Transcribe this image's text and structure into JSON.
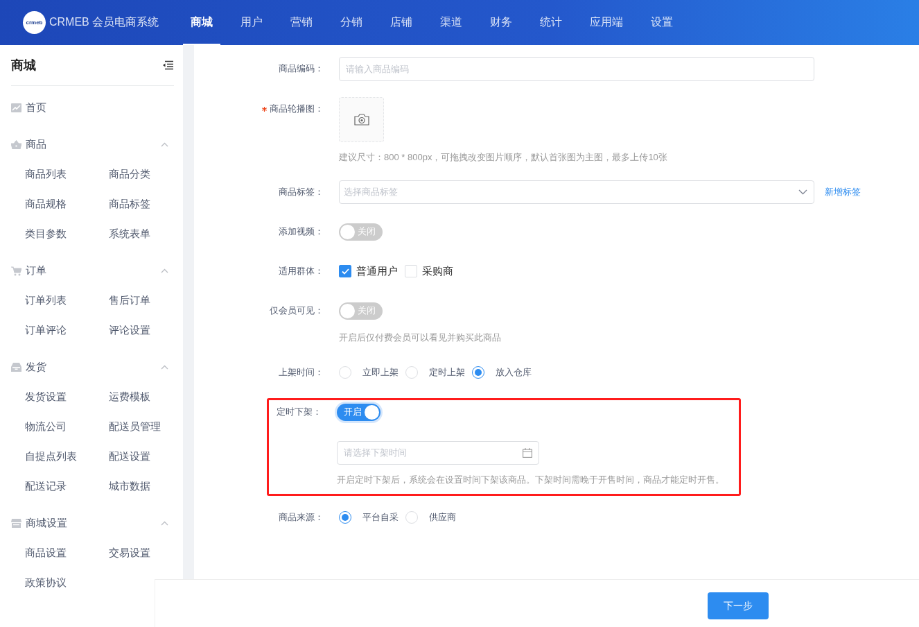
{
  "header": {
    "logo_mark": "crmeb",
    "logo_text": "CRMEB 会员电商系统",
    "nav": [
      {
        "label": "商城",
        "selected": true
      },
      {
        "label": "用户",
        "selected": false
      },
      {
        "label": "营销",
        "selected": false
      },
      {
        "label": "分销",
        "selected": false
      },
      {
        "label": "店铺",
        "selected": false
      },
      {
        "label": "渠道",
        "selected": false
      },
      {
        "label": "财务",
        "selected": false
      },
      {
        "label": "统计",
        "selected": false
      },
      {
        "label": "应用端",
        "selected": false
      },
      {
        "label": "设置",
        "selected": false
      }
    ]
  },
  "sidebar": {
    "title": "商城",
    "sections": [
      {
        "kind": "link",
        "label": "首页"
      },
      {
        "kind": "group",
        "label": "商品",
        "expanded": true,
        "items": [
          "商品列表",
          "商品分类",
          "商品规格",
          "商品标签",
          "类目参数",
          "系统表单"
        ]
      },
      {
        "kind": "group",
        "label": "订单",
        "expanded": true,
        "items": [
          "订单列表",
          "售后订单",
          "订单评论",
          "评论设置"
        ]
      },
      {
        "kind": "group",
        "label": "发货",
        "expanded": true,
        "items": [
          "发货设置",
          "运费模板",
          "物流公司",
          "配送员管理",
          "自提点列表",
          "配送设置",
          "配送记录",
          "城市数据"
        ]
      },
      {
        "kind": "group",
        "label": "商城设置",
        "expanded": true,
        "items": [
          "商品设置",
          "交易设置",
          "政策协议"
        ]
      }
    ]
  },
  "form": {
    "rows": [
      {
        "kind": "input",
        "label": "商品编码：",
        "required": false,
        "highlighted": false,
        "placeholder": "请输入商品编码"
      },
      {
        "kind": "upload",
        "label": "商品轮播图：",
        "required": true,
        "highlighted": false,
        "hint": "建议尺寸：800 * 800px，可拖拽改变图片顺序，默认首张图为主图，最多上传10张"
      },
      {
        "kind": "select",
        "label": "商品标签：",
        "required": false,
        "highlighted": false,
        "placeholder": "选择商品标签",
        "link": "新增标签"
      },
      {
        "kind": "switch",
        "label": "添加视频：",
        "required": false,
        "highlighted": false,
        "on": false,
        "switch_text": "关闭"
      },
      {
        "kind": "checkboxes",
        "label": "适用群体：",
        "required": false,
        "highlighted": false,
        "options": [
          {
            "label": "普通用户",
            "checked": true
          },
          {
            "label": "采购商",
            "checked": false
          }
        ]
      },
      {
        "kind": "switch",
        "label": "仅会员可见：",
        "required": false,
        "highlighted": false,
        "on": false,
        "switch_text": "关闭",
        "hint": "开启后仅付费会员可以看见并购买此商品"
      },
      {
        "kind": "radios",
        "label": "上架时间：",
        "required": false,
        "highlighted": false,
        "options": [
          {
            "label": "立即上架",
            "selected": false
          },
          {
            "label": "定时上架",
            "selected": false
          },
          {
            "label": "放入仓库",
            "selected": true
          }
        ]
      },
      {
        "kind": "switch",
        "label": "定时下架：",
        "required": false,
        "highlighted": true,
        "on": true,
        "switch_text": "开启",
        "picker_placeholder": "请选择下架时间",
        "hint": "开启定时下架后，系统会在设置时间下架该商品。下架时间需晚于开售时间，商品才能定时开售。"
      },
      {
        "kind": "radios",
        "label": "商品来源：",
        "required": false,
        "highlighted": false,
        "options": [
          {
            "label": "平台自采",
            "selected": true
          },
          {
            "label": "供应商",
            "selected": false
          }
        ]
      }
    ]
  },
  "footer": {
    "next_button": "下一步"
  }
}
